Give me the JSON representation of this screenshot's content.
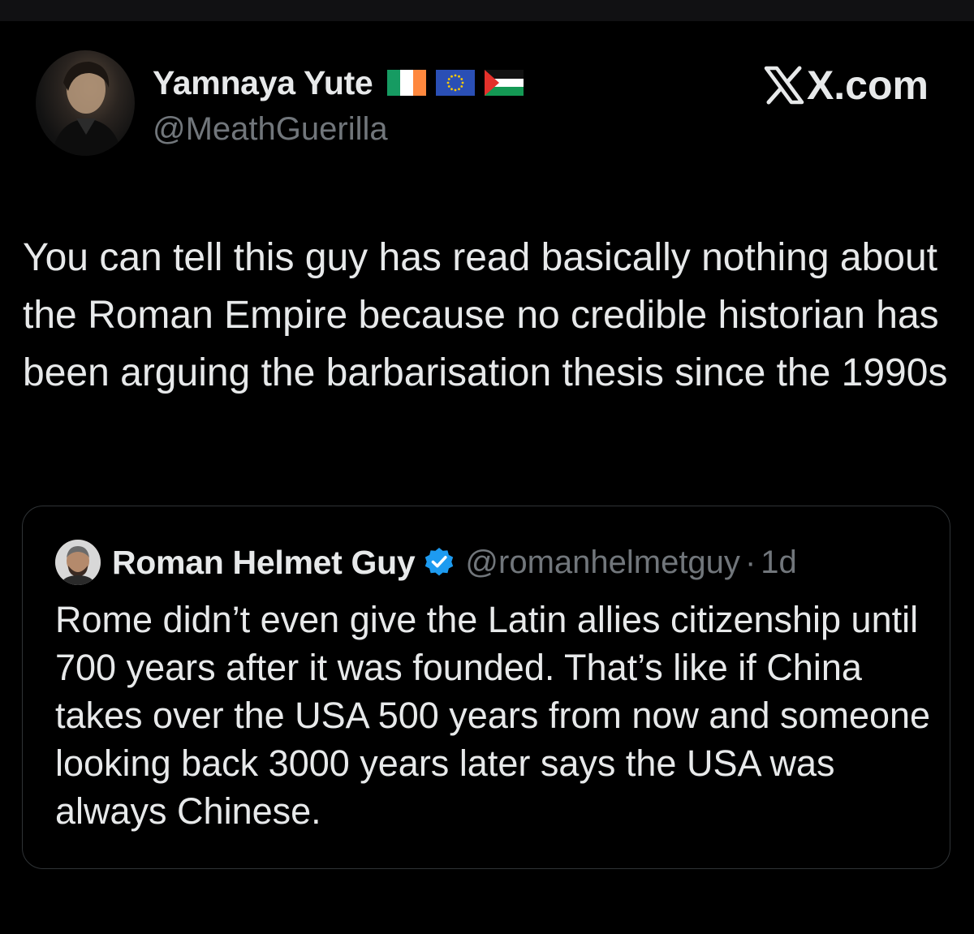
{
  "post": {
    "author": {
      "name": "Yamnaya Yute",
      "handle": "@MeathGuerilla",
      "flags": [
        "ireland-flag",
        "eu-flag",
        "palestine-flag"
      ]
    },
    "brand": "X.com",
    "text": "You can tell this guy has read basically nothing about the Roman Empire because no credible historian has been arguing the barbarisation thesis since the 1990s"
  },
  "quoted": {
    "author": {
      "name": "Roman Helmet Guy",
      "handle": "@romanhelmetguy",
      "verified": true
    },
    "separator": "·",
    "time": "1d",
    "text": "Rome didn’t even give the Latin allies citizenship until 700 years after it was founded. That’s like if China takes over the USA 500 years from now and someone looking back 3000 years later says the USA was always Chinese."
  },
  "colors": {
    "background": "#000000",
    "text_primary": "#e7e9ea",
    "text_secondary": "#71767b",
    "border": "#2f3336",
    "verified": "#1d9bf0"
  },
  "icons": {
    "brand": "x-logo-icon",
    "verified": "verified-badge-icon"
  }
}
